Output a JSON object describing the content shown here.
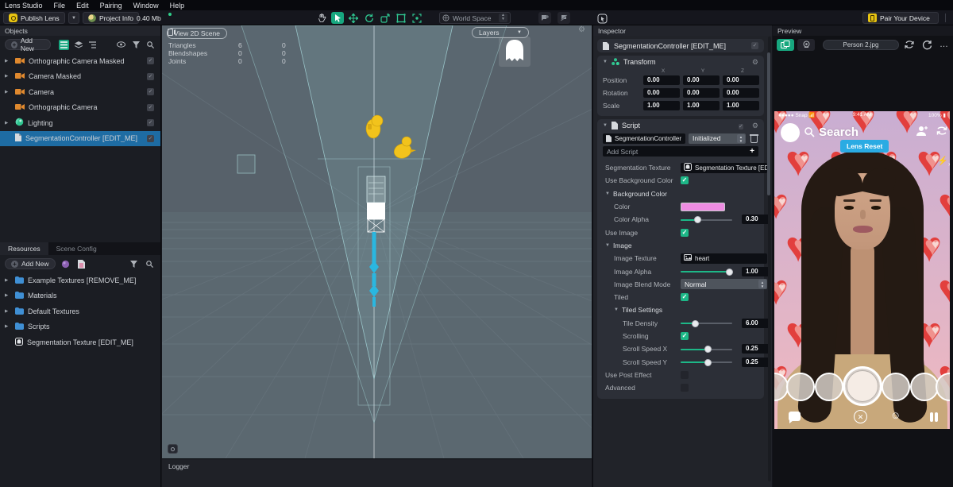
{
  "menu": {
    "items": [
      "Lens Studio",
      "File",
      "Edit",
      "Pairing",
      "Window",
      "Help"
    ]
  },
  "toolbar": {
    "publish_label": "Publish Lens",
    "project_info_label": "Project Info",
    "project_size": "0.40 Mb",
    "world_space_label": "World Space",
    "pair_label": "Pair Your Device",
    "tool_icons": [
      "pan-hand-icon",
      "select-cursor-icon",
      "move-axes-icon",
      "rotate-icon",
      "local-space-icon",
      "rect-transform-icon",
      "focus-center-icon"
    ]
  },
  "objects_panel": {
    "title": "Objects",
    "add_new": "Add New",
    "items": [
      {
        "label": "Orthographic Camera Masked",
        "icon": "camera",
        "expandable": true,
        "selected": false
      },
      {
        "label": "Camera Masked",
        "icon": "camera",
        "expandable": true,
        "selected": false
      },
      {
        "label": "Camera",
        "icon": "camera",
        "expandable": true,
        "selected": false
      },
      {
        "label": "Orthographic Camera",
        "icon": "camera",
        "expandable": false,
        "selected": false
      },
      {
        "label": "Lighting",
        "icon": "lighting",
        "expandable": true,
        "selected": false
      },
      {
        "label": "SegmentationController [EDIT_ME]",
        "icon": "script",
        "expandable": false,
        "selected": true
      }
    ]
  },
  "resources_panel": {
    "tabs": [
      "Resources",
      "Scene Config"
    ],
    "add_new": "Add New",
    "items": [
      {
        "label": "Example Textures [REMOVE_ME]",
        "icon": "folder",
        "expandable": true
      },
      {
        "label": "Materials",
        "icon": "folder",
        "expandable": true
      },
      {
        "label": "Default Textures",
        "icon": "folder",
        "expandable": true
      },
      {
        "label": "Scripts",
        "icon": "folder",
        "expandable": true
      },
      {
        "label": "Segmentation Texture [EDIT_ME]",
        "icon": "texture",
        "expandable": false
      }
    ]
  },
  "scene": {
    "view_2d_label": "View 2D Scene",
    "layers_label": "Layers",
    "stats": [
      {
        "label": "Triangles",
        "col1": "6",
        "col2": "0"
      },
      {
        "label": "Blendshapes",
        "col1": "0",
        "col2": "0"
      },
      {
        "label": "Joints",
        "col1": "0",
        "col2": "0"
      }
    ]
  },
  "logger": {
    "title": "Logger"
  },
  "inspector": {
    "title": "Inspector",
    "object_name": "SegmentationController [EDIT_ME]",
    "transform": {
      "title": "Transform",
      "axes": [
        "X",
        "Y",
        "Z"
      ],
      "rows": [
        {
          "label": "Position",
          "values": [
            "0.00",
            "0.00",
            "0.00"
          ]
        },
        {
          "label": "Rotation",
          "values": [
            "0.00",
            "0.00",
            "0.00"
          ]
        },
        {
          "label": "Scale",
          "values": [
            "1.00",
            "1.00",
            "1.00"
          ]
        }
      ]
    },
    "script": {
      "title": "Script",
      "component": "SegmentationController",
      "event": "Initialized",
      "add_script": "Add Script",
      "props": [
        {
          "label": "Segmentation Texture",
          "type": "resource",
          "value": "Segmentation Texture [EDIT_ME]",
          "icon": "texture",
          "indent": 0
        },
        {
          "label": "Use Background Color",
          "type": "check",
          "checked": true,
          "indent": 0
        },
        {
          "label": "Background Color",
          "type": "group",
          "indent": 0
        },
        {
          "label": "Color",
          "type": "swatch",
          "value": "#ee8ce2",
          "indent": 1
        },
        {
          "label": "Color Alpha",
          "type": "slider",
          "value": "0.30",
          "fraction": 0.33,
          "indent": 1
        },
        {
          "label": "Use Image",
          "type": "check",
          "checked": true,
          "indent": 0
        },
        {
          "label": "Image",
          "type": "group",
          "indent": 0
        },
        {
          "label": "Image Texture",
          "type": "resource",
          "value": "heart",
          "icon": "image",
          "indent": 1
        },
        {
          "label": "Image Alpha",
          "type": "slider",
          "value": "1.00",
          "fraction": 0.95,
          "indent": 1
        },
        {
          "label": "Image Blend Mode",
          "type": "dropdown",
          "value": "Normal",
          "indent": 1
        },
        {
          "label": "Tiled",
          "type": "check",
          "checked": true,
          "indent": 1
        },
        {
          "label": "Tiled Settings",
          "type": "group",
          "indent": 1
        },
        {
          "label": "Tile Density",
          "type": "slider",
          "value": "6.00",
          "fraction": 0.29,
          "indent": 2
        },
        {
          "label": "Scrolling",
          "type": "check",
          "checked": true,
          "indent": 2
        },
        {
          "label": "Scroll Speed X",
          "type": "slider",
          "value": "0.25",
          "fraction": 0.53,
          "indent": 2
        },
        {
          "label": "Scroll Speed Y",
          "type": "slider",
          "value": "0.25",
          "fraction": 0.53,
          "indent": 2
        },
        {
          "label": "Use Post Effect",
          "type": "check",
          "checked": false,
          "indent": 0
        },
        {
          "label": "Advanced",
          "type": "check",
          "checked": false,
          "indent": 0
        }
      ]
    }
  },
  "preview": {
    "title": "Preview",
    "source": "Person 2.jpg",
    "phone": {
      "carrier": "Snap",
      "time": "9:41 AM",
      "battery": "100%",
      "search_label": "Search",
      "lens_reset_label": "Lens Reset"
    }
  },
  "colors": {
    "accent_green": "#1db787",
    "selection_blue": "#1e6ca3",
    "background_color_swatch": "#ee8ce2",
    "lens_reset_blue": "#2aabe3",
    "publish_yellow": "#e8c412"
  }
}
